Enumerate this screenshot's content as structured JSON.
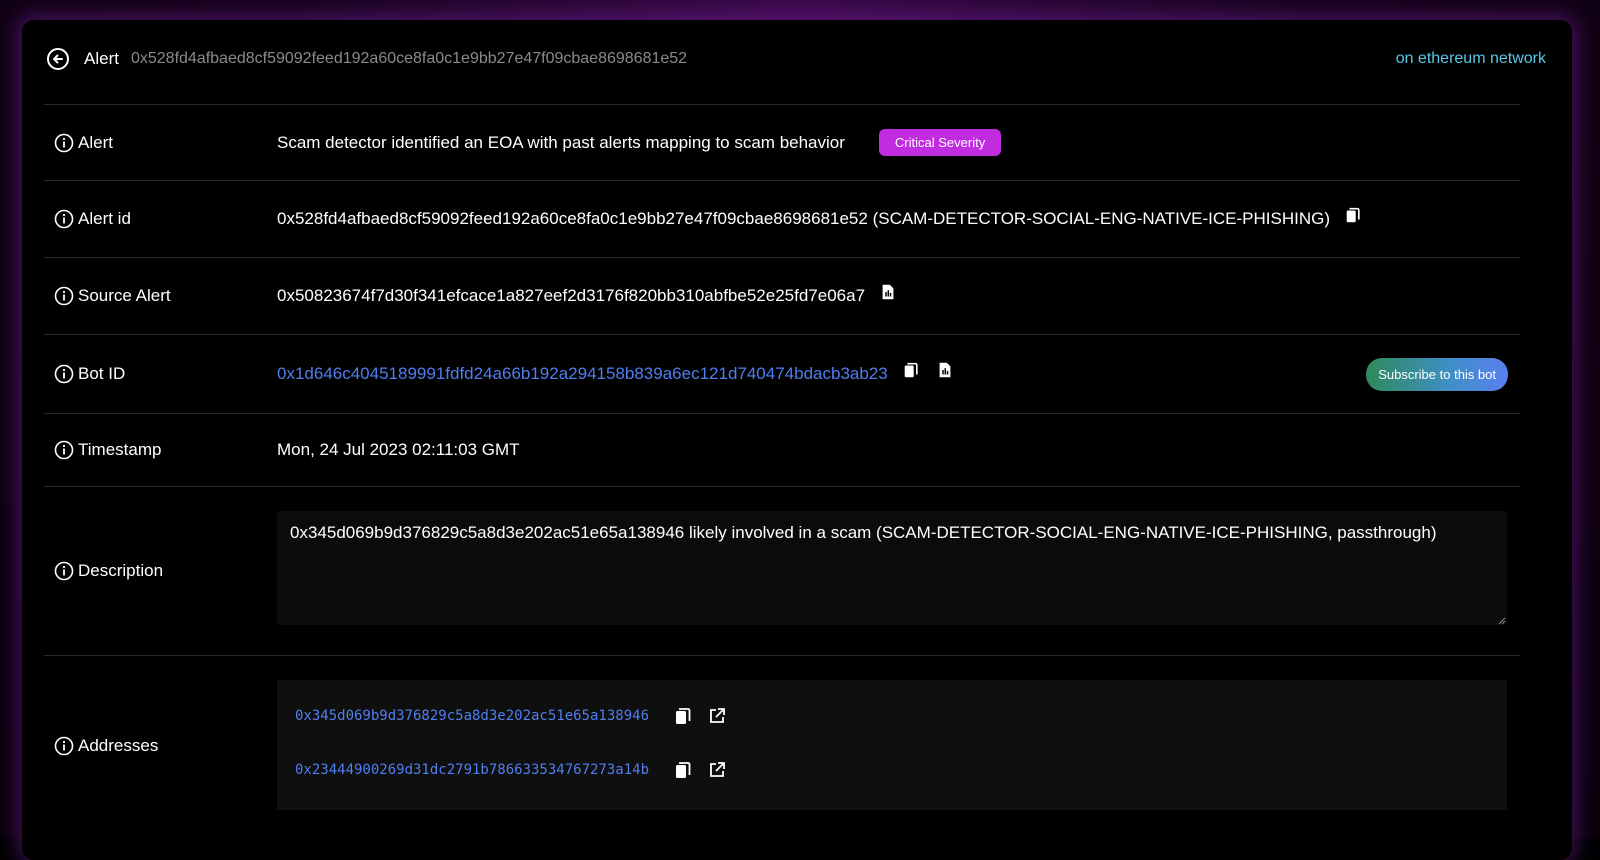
{
  "header": {
    "label": "Alert",
    "hash": "0x528fd4afbaed8cf59092feed192a60ce8fa0c1e9bb27e47f09cbae8698681e52",
    "network": "on ethereum network"
  },
  "rows": {
    "alert": {
      "label": "Alert",
      "value": "Scam detector identified an EOA with past alerts mapping to scam behavior",
      "badge": "Critical Severity"
    },
    "alert_id": {
      "label": "Alert id",
      "value": "0x528fd4afbaed8cf59092feed192a60ce8fa0c1e9bb27e47f09cbae8698681e52 (SCAM-DETECTOR-SOCIAL-ENG-NATIVE-ICE-PHISHING)"
    },
    "source_alert": {
      "label": "Source Alert",
      "value": "0x50823674f7d30f341efcace1a827eef2d3176f820bb310abfbe52e25fd7e06a7"
    },
    "bot_id": {
      "label": "Bot ID",
      "value": "0x1d646c4045189991fdfd24a66b192a294158b839a6ec121d740474bdacb3ab23",
      "subscribe_label": "Subscribe to this bot"
    },
    "timestamp": {
      "label": "Timestamp",
      "value": "Mon, 24 Jul 2023 02:11:03 GMT"
    },
    "description": {
      "label": "Description",
      "value": "0x345d069b9d376829c5a8d3e202ac51e65a138946 likely involved in a scam (SCAM-DETECTOR-SOCIAL-ENG-NATIVE-ICE-PHISHING, passthrough)"
    },
    "addresses": {
      "label": "Addresses",
      "items": [
        "0x345d069b9d376829c5a8d3e202ac51e65a138946",
        "0x23444900269d31dc2791b786633534767273a14b"
      ]
    }
  },
  "colors": {
    "accent_link": "#4f7ef0",
    "network_text": "#5bc6e8",
    "critical_badge": "#c12ce0"
  }
}
